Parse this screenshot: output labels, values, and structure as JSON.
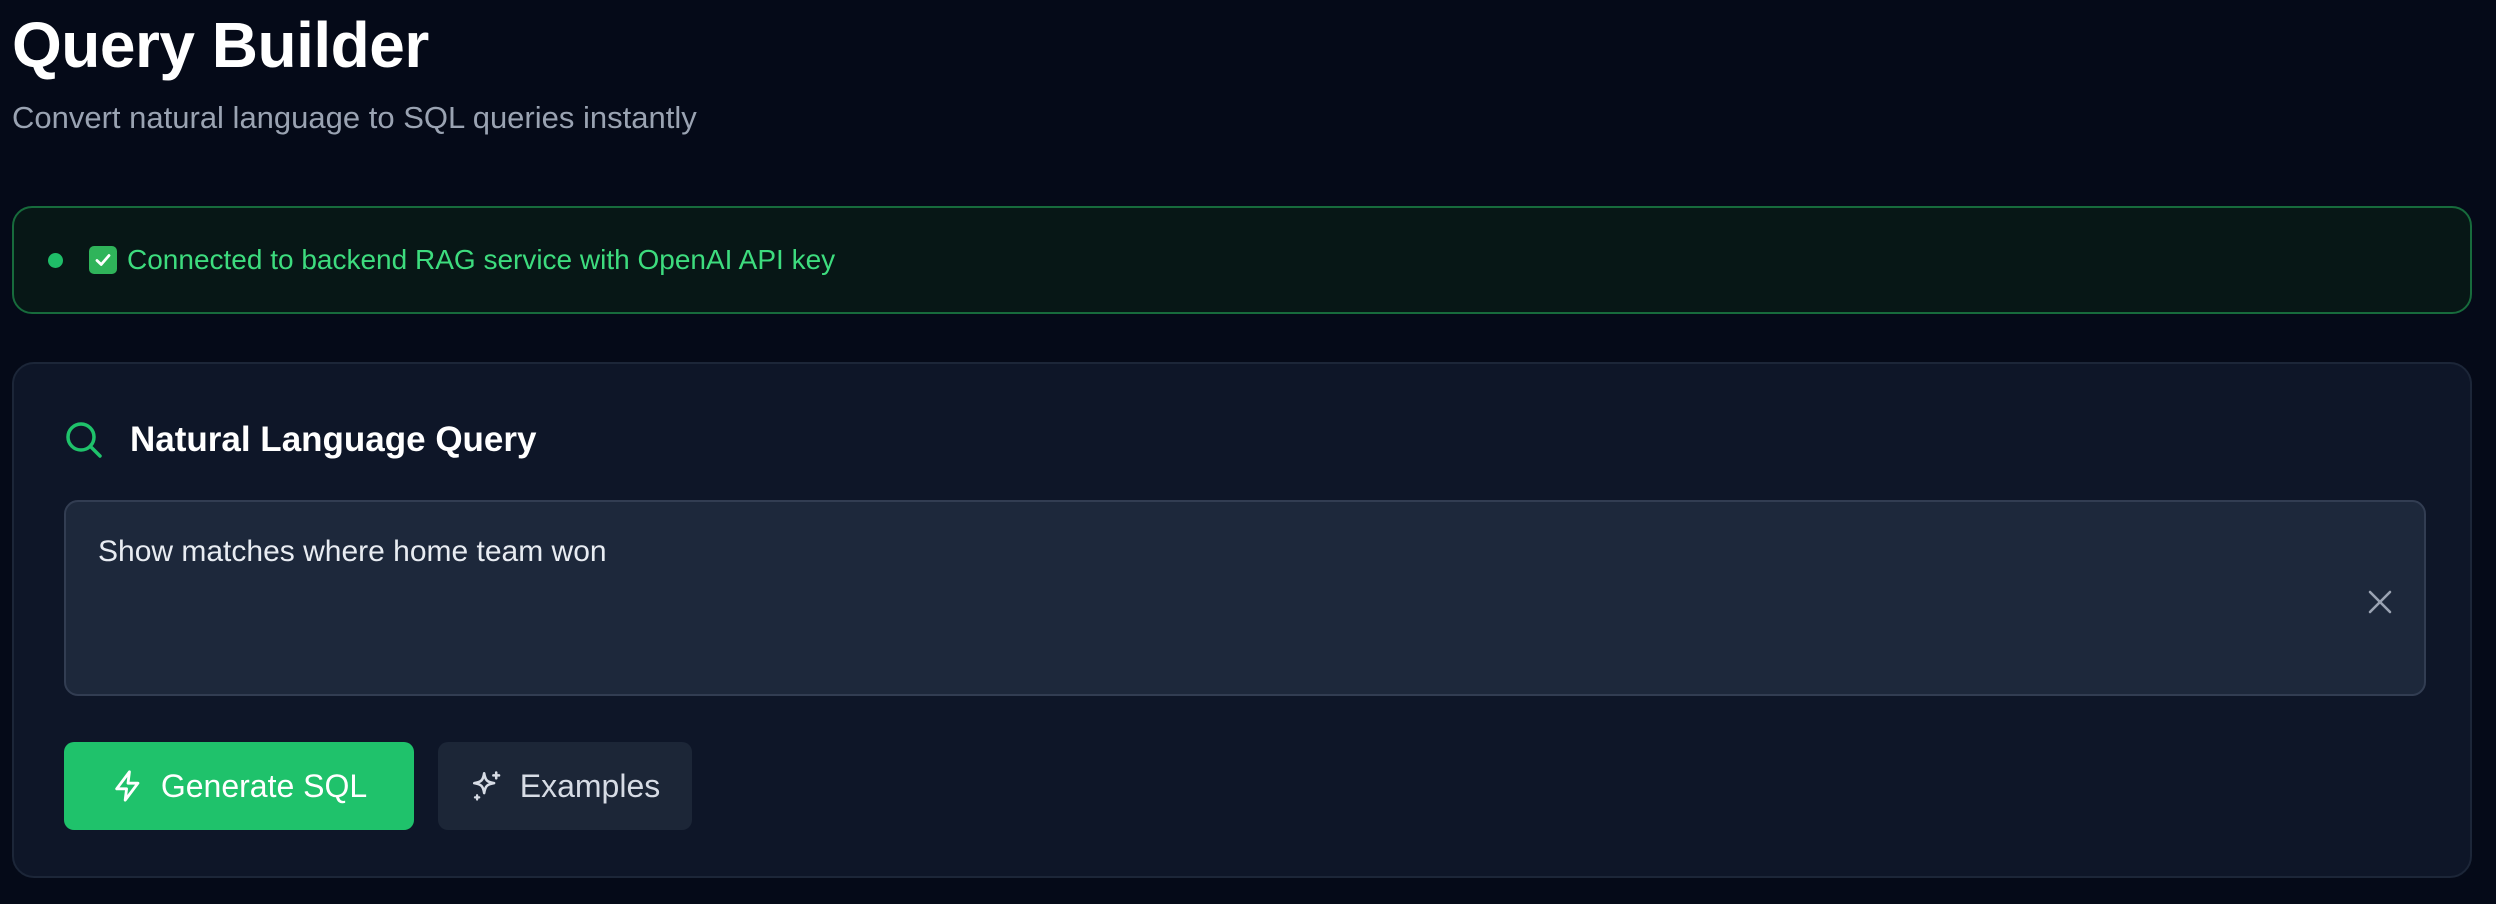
{
  "header": {
    "title": "Query Builder",
    "subtitle": "Convert natural language to SQL queries instantly"
  },
  "status": {
    "text": "Connected to backend RAG service with OpenAI API key",
    "icon": "check-box-icon",
    "color": "#3ddc7e"
  },
  "query_card": {
    "title": "Natural Language Query",
    "icon": "search-icon",
    "input_value": "Show matches where home team won",
    "clear_icon": "close-icon",
    "buttons": {
      "generate_label": "Generate SQL",
      "generate_icon": "lightning-icon",
      "examples_label": "Examples",
      "examples_icon": "sparkles-icon"
    }
  },
  "colors": {
    "background": "#050a18",
    "accent": "#1fc26b",
    "card": "#0e1628",
    "input": "#1d283b"
  }
}
